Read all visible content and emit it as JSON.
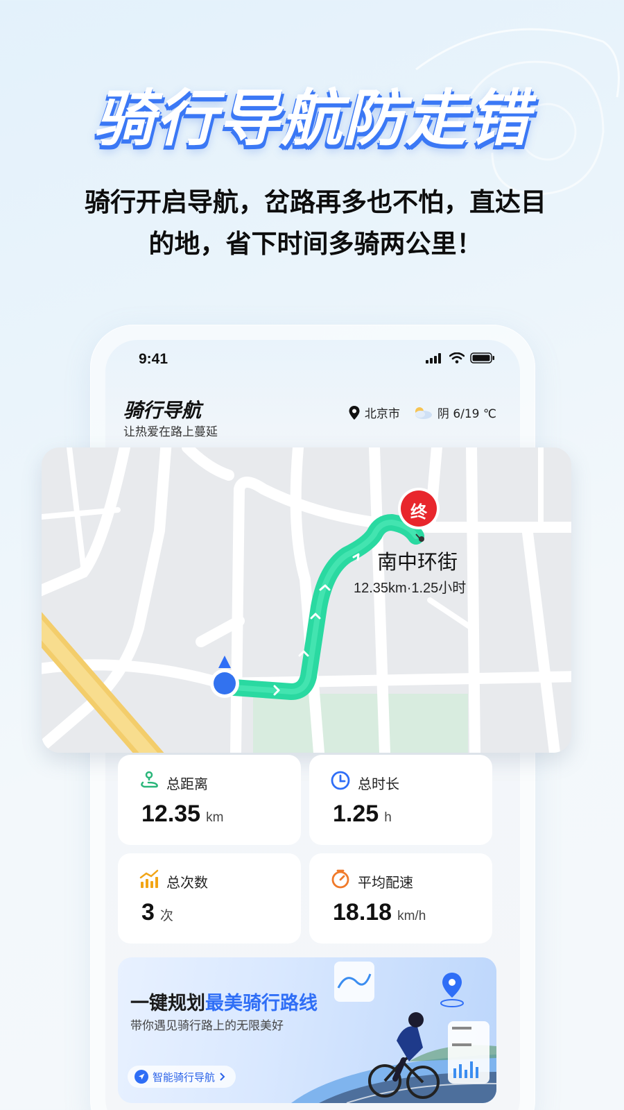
{
  "promo": {
    "headline": "骑行导航防走错",
    "subline_1": "骑行开启导航，岔路再多也不怕，直达目",
    "subline_2": "的地，省下时间多骑两公里！"
  },
  "status_bar": {
    "time": "9:41"
  },
  "app": {
    "title": "骑行导航",
    "slogan": "让热爱在路上蔓延",
    "city": "北京市",
    "weather": "阴 6/19 ℃"
  },
  "map": {
    "destination_marker": "终",
    "destination_name": "南中环街",
    "route_summary": "12.35km·1.25小时"
  },
  "stats": [
    {
      "label": "总距离",
      "value": "12.35",
      "unit": "km",
      "icon": "route-icon"
    },
    {
      "label": "总时长",
      "value": "1.25",
      "unit": "h",
      "icon": "clock-icon"
    },
    {
      "label": "总次数",
      "value": "3",
      "unit": "次",
      "icon": "chart-icon"
    },
    {
      "label": "平均配速",
      "value": "18.18",
      "unit": "km/h",
      "icon": "timer-icon"
    }
  ],
  "banner": {
    "title_prefix": "一键规划",
    "title_highlight": "最美骑行路线",
    "subtitle": "带你遇见骑行路上的无限美好",
    "button": "智能骑行导航"
  },
  "colors": {
    "accent_blue": "#3b78f5",
    "route_green": "#2fe0a8",
    "destination_red": "#e8262c"
  }
}
